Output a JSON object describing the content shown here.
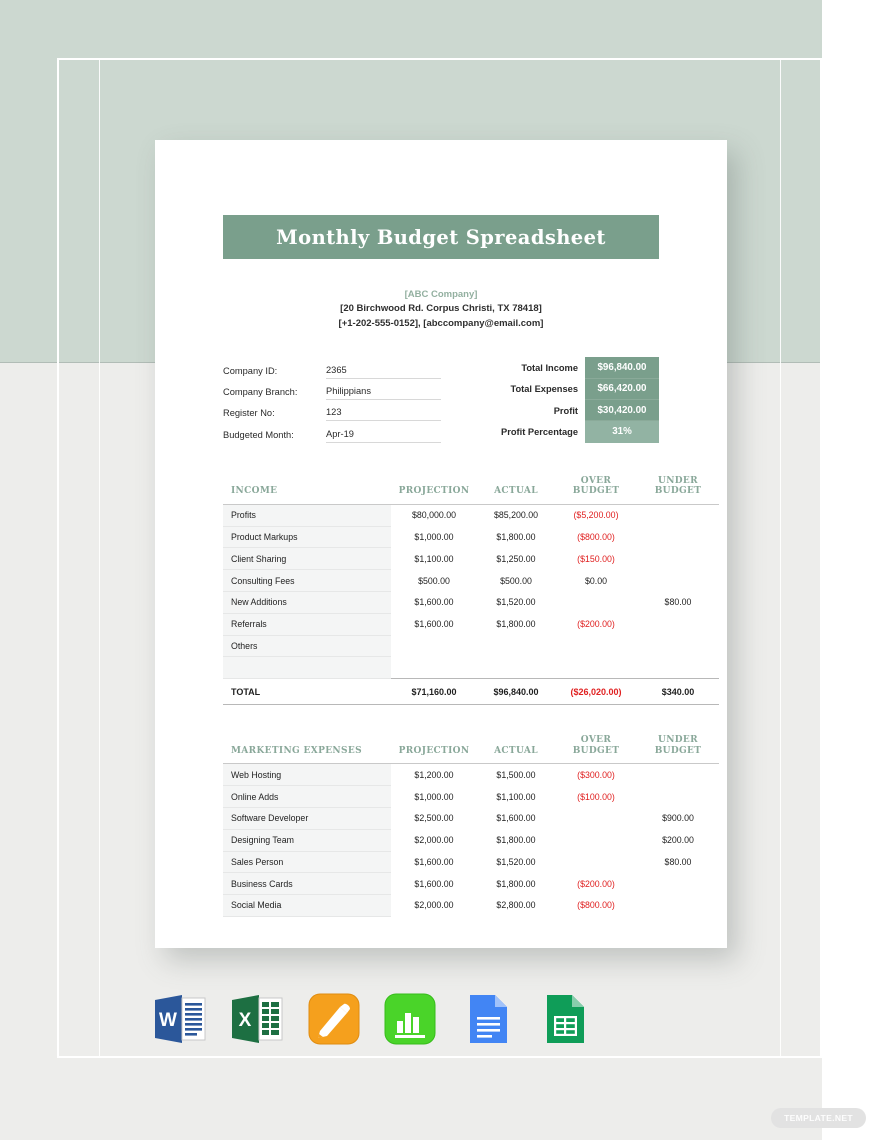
{
  "document": {
    "title": "Monthly Budget Spreadsheet",
    "company": {
      "name": "[ABC Company]",
      "address": "[20 Birchwood Rd. Corpus Christi, TX 78418]",
      "contact": "[+1-202-555-0152], [abccompany@email.com]"
    },
    "info_fields": [
      {
        "label": "Company ID:",
        "value": "2365"
      },
      {
        "label": "Company Branch:",
        "value": "Philippians"
      },
      {
        "label": "Register No:",
        "value": "123"
      },
      {
        "label": "Budgeted Month:",
        "value": "Apr-19"
      }
    ],
    "summary": [
      {
        "label": "Total Income",
        "value": "$96,840.00"
      },
      {
        "label": "Total Expenses",
        "value": "$66,420.00"
      },
      {
        "label": "Profit",
        "value": "$30,420.00"
      },
      {
        "label": "Profit Percentage",
        "value": "31%"
      }
    ],
    "income_table": {
      "headers": {
        "name": "INCOME",
        "projection": "PROJECTION",
        "actual": "ACTUAL",
        "over_budget_line1": "OVER",
        "over_budget_line2": "BUDGET",
        "under_budget_line1": "UNDER",
        "under_budget_line2": "BUDGET"
      },
      "rows": [
        {
          "name": "Profits",
          "projection": "$80,000.00",
          "actual": "$85,200.00",
          "over": "($5,200.00)",
          "under": ""
        },
        {
          "name": "Product Markups",
          "projection": "$1,000.00",
          "actual": "$1,800.00",
          "over": "($800.00)",
          "under": ""
        },
        {
          "name": "Client Sharing",
          "projection": "$1,100.00",
          "actual": "$1,250.00",
          "over": "($150.00)",
          "under": ""
        },
        {
          "name": "Consulting Fees",
          "projection": "$500.00",
          "actual": "$500.00",
          "over": "$0.00",
          "under": "",
          "over_positive": true
        },
        {
          "name": "New Additions",
          "projection": "$1,600.00",
          "actual": "$1,520.00",
          "over": "",
          "under": "$80.00"
        },
        {
          "name": "Referrals",
          "projection": "$1,600.00",
          "actual": "$1,800.00",
          "over": "($200.00)",
          "under": ""
        },
        {
          "name": "Others",
          "projection": "",
          "actual": "",
          "over": "",
          "under": ""
        },
        {
          "name": "",
          "projection": "",
          "actual": "",
          "over": "",
          "under": ""
        }
      ],
      "total": {
        "name": "TOTAL",
        "projection": "$71,160.00",
        "actual": "$96,840.00",
        "over": "($26,020.00)",
        "under": "$340.00"
      }
    },
    "expenses_table": {
      "headers": {
        "name": "MARKETING EXPENSES",
        "projection": "PROJECTION",
        "actual": "ACTUAL",
        "over_budget_line1": "OVER",
        "over_budget_line2": "BUDGET",
        "under_budget_line1": "UNDER",
        "under_budget_line2": "BUDGET"
      },
      "rows": [
        {
          "name": "Web Hosting",
          "projection": "$1,200.00",
          "actual": "$1,500.00",
          "over": "($300.00)",
          "under": ""
        },
        {
          "name": "Online Adds",
          "projection": "$1,000.00",
          "actual": "$1,100.00",
          "over": "($100.00)",
          "under": ""
        },
        {
          "name": "Software Developer",
          "projection": "$2,500.00",
          "actual": "$1,600.00",
          "over": "",
          "under": "$900.00"
        },
        {
          "name": "Designing Team",
          "projection": "$2,000.00",
          "actual": "$1,800.00",
          "over": "",
          "under": "$200.00"
        },
        {
          "name": "Sales Person",
          "projection": "$1,600.00",
          "actual": "$1,520.00",
          "over": "",
          "under": "$80.00"
        },
        {
          "name": "Business Cards",
          "projection": "$1,600.00",
          "actual": "$1,800.00",
          "over": "($200.00)",
          "under": ""
        },
        {
          "name": "Social Media",
          "projection": "$2,000.00",
          "actual": "$2,800.00",
          "over": "($800.00)",
          "under": ""
        }
      ]
    }
  },
  "app_icons": [
    {
      "name": "microsoft-word-icon",
      "label": "W"
    },
    {
      "name": "microsoft-excel-icon",
      "label": "X"
    },
    {
      "name": "apple-pages-icon",
      "label": ""
    },
    {
      "name": "apple-numbers-icon",
      "label": ""
    },
    {
      "name": "google-docs-icon",
      "label": ""
    },
    {
      "name": "google-sheets-icon",
      "label": ""
    }
  ],
  "watermark": {
    "text": "TEMPLATE.NET"
  },
  "colors": {
    "brand_green": "#7a9f8c",
    "brand_green_light": "#92b3a3",
    "header_text": "#8aa89a",
    "negative": "#e02020",
    "backdrop_top": "#ccd8d0",
    "backdrop_bottom": "#ededeb"
  }
}
